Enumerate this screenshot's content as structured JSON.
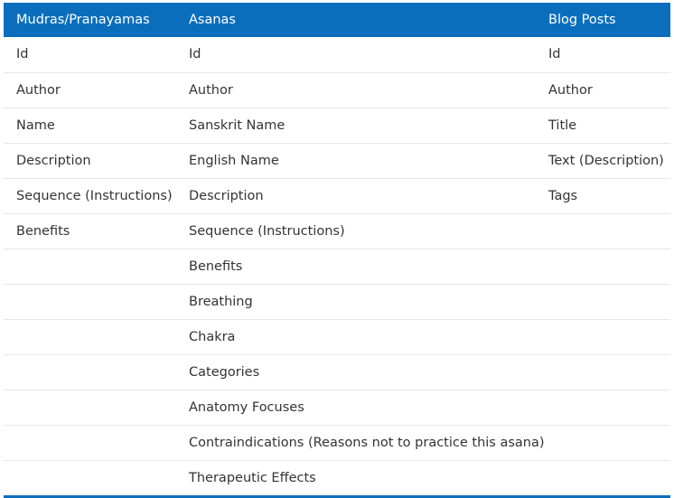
{
  "table": {
    "headers": [
      "Mudras/Pranayamas",
      "Asanas",
      "Blog Posts"
    ],
    "rows": [
      [
        "Id",
        "Id",
        "Id"
      ],
      [
        "Author",
        "Author",
        "Author"
      ],
      [
        "Name",
        "Sanskrit Name",
        "Title"
      ],
      [
        "Description",
        "English Name",
        "Text (Description)"
      ],
      [
        "Sequence (Instructions)",
        "Description",
        "Tags"
      ],
      [
        "Benefits",
        "Sequence (Instructions)",
        ""
      ],
      [
        "",
        "Benefits",
        ""
      ],
      [
        "",
        "Breathing",
        ""
      ],
      [
        "",
        "Chakra",
        ""
      ],
      [
        "",
        "Categories",
        ""
      ],
      [
        "",
        "Anatomy Focuses",
        ""
      ],
      [
        "",
        "Contraindications (Reasons not to practice this asana)",
        ""
      ],
      [
        "",
        "Therapeutic Effects",
        ""
      ]
    ]
  },
  "colors": {
    "header_bg": "#0a6ebd",
    "header_text": "#ffffff",
    "body_text": "#333333",
    "row_divider": "#e6e6e6"
  }
}
